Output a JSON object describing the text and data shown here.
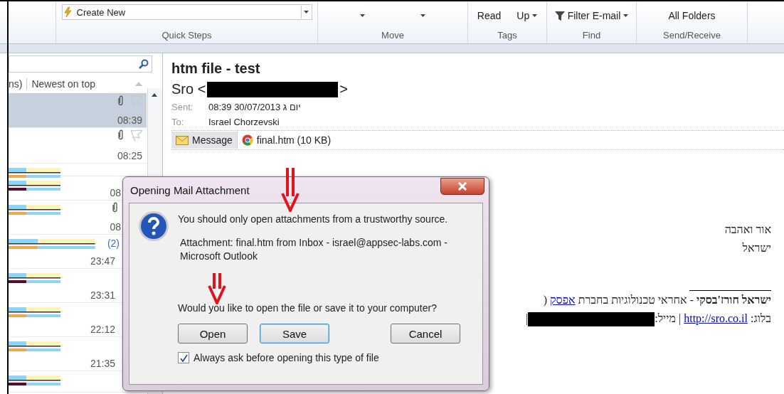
{
  "ribbon": {
    "groups": [
      {
        "kind": "quicksteps",
        "label": "Quick Steps",
        "combo": "Create New"
      },
      {
        "kind": "move",
        "label": "Move"
      },
      {
        "kind": "buttons",
        "label": "Tags",
        "buttons": [
          {
            "label": "Read",
            "dropdown": false
          },
          {
            "label": "Up",
            "dropdown": true
          }
        ]
      },
      {
        "kind": "filter",
        "label": "Find",
        "buttons": [
          {
            "label": "Filter E-mail",
            "dropdown": true
          }
        ]
      },
      {
        "kind": "buttons",
        "label": "Send/Receive",
        "buttons": [
          {
            "label": "All Folders",
            "dropdown": false
          }
        ]
      }
    ]
  },
  "message_list": {
    "columns": [
      "ns)",
      "Newest on top"
    ],
    "rows": [
      {
        "kind": "plain",
        "selected": true,
        "attachment": true,
        "flag": true,
        "time": "08:39"
      },
      {
        "kind": "plain",
        "selected": false,
        "attachment": true,
        "flag": true,
        "time": "08:25"
      },
      {
        "kind": "garbled",
        "selected": false,
        "attachment": false,
        "flag": false
      },
      {
        "kind": "garbled",
        "selected": false,
        "attachment": false,
        "flag": false,
        "time": "08"
      },
      {
        "kind": "garbled",
        "selected": false,
        "attachment": true,
        "flag": false,
        "time": "08"
      },
      {
        "kind": "garbled",
        "selected": false,
        "attachment": false,
        "flag": false,
        "count": "(2)",
        "time": "23:47"
      },
      {
        "kind": "garbled",
        "selected": false,
        "attachment": false,
        "flag": false,
        "time": "23:31"
      },
      {
        "kind": "garbled",
        "selected": false,
        "attachment": false,
        "flag": false,
        "time": "22:12"
      },
      {
        "kind": "garbled",
        "selected": false,
        "attachment": false,
        "flag": false,
        "time": "21:35"
      },
      {
        "kind": "garbled",
        "selected": false,
        "attachment": false,
        "flag": false
      }
    ]
  },
  "message": {
    "subject": "htm file - test",
    "sender_name": "Sro <",
    "sender_close": ">",
    "sent_label": "Sent:",
    "sent": "08:39 30/07/2013 יום ג",
    "to_label": "To:",
    "to": "Israel Chorzevski",
    "attachments": [
      {
        "kind": "message",
        "label": "Message",
        "selected": true
      },
      {
        "kind": "file",
        "label": "final.htm (10 KB)",
        "selected": false
      }
    ],
    "body": [
      {
        "kind": "text",
        "text": "אור ואהבה"
      },
      {
        "kind": "text",
        "text": "ישראל"
      },
      {
        "kind": "rule"
      },
      {
        "kind": "link_line",
        "before": "**ישראל חורז'בסקי** - אחראי טכנולוגיות בחברת ",
        "link": "אפסק",
        "after": " ("
      },
      {
        "kind": "link_line",
        "before": "בלוג: ",
        "link": "http://sro.co.il",
        "after": " | מייל:",
        "redacted": true,
        "tail": "|"
      }
    ]
  },
  "dialog": {
    "title": "Opening Mail Attachment",
    "warning": "You should only open attachments from a trustworthy source.",
    "details": "Attachment: final.htm from Inbox - israel@appsec-labs.com - Microsoft Outlook",
    "question": "Would you like to open the file or save it to your computer?",
    "buttons": [
      {
        "label": "Open",
        "selected": false
      },
      {
        "label": "Save",
        "selected": true
      },
      {
        "label": "Cancel",
        "selected": false
      }
    ],
    "checkbox": {
      "label": "Always ask before opening this type of file",
      "checked": true
    }
  }
}
